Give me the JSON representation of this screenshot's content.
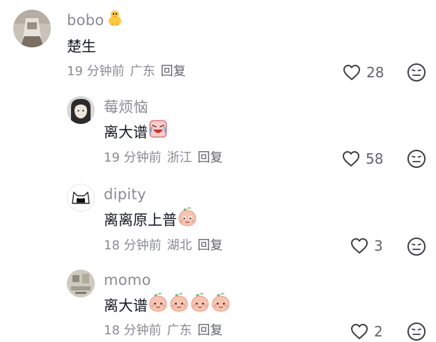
{
  "comments": [
    {
      "username": "bobo",
      "username_emoji": "chick-emoji",
      "text": "楚生",
      "time": "19 分钟前",
      "location": "广东",
      "reply_label": "回复",
      "likes": "28"
    },
    {
      "username": "莓烦恼",
      "text": "离大谱",
      "text_emojis": [
        "laughing-tears-emoji"
      ],
      "time": "19 分钟前",
      "location": "浙江",
      "reply_label": "回复",
      "likes": "58"
    },
    {
      "username": "dipity",
      "text": "离离原上普",
      "text_emojis": [
        "peach-face-emoji"
      ],
      "time": "18 分钟前",
      "location": "湖北",
      "reply_label": "回复",
      "likes": "3"
    },
    {
      "username": "momo",
      "text": "离大谱",
      "text_emojis": [
        "peach-face-emoji",
        "peach-face-emoji",
        "peach-face-emoji",
        "peach-face-emoji"
      ],
      "time": "18 分钟前",
      "location": "广东",
      "reply_label": "回复",
      "likes": "2"
    }
  ],
  "icons": {
    "like": "heart-outline-icon",
    "dislike": "neutral-face-icon"
  },
  "colors": {
    "username": "#8a8b91",
    "text": "#161823",
    "meta": "#8a8b91",
    "icon": "#3b3c42"
  }
}
